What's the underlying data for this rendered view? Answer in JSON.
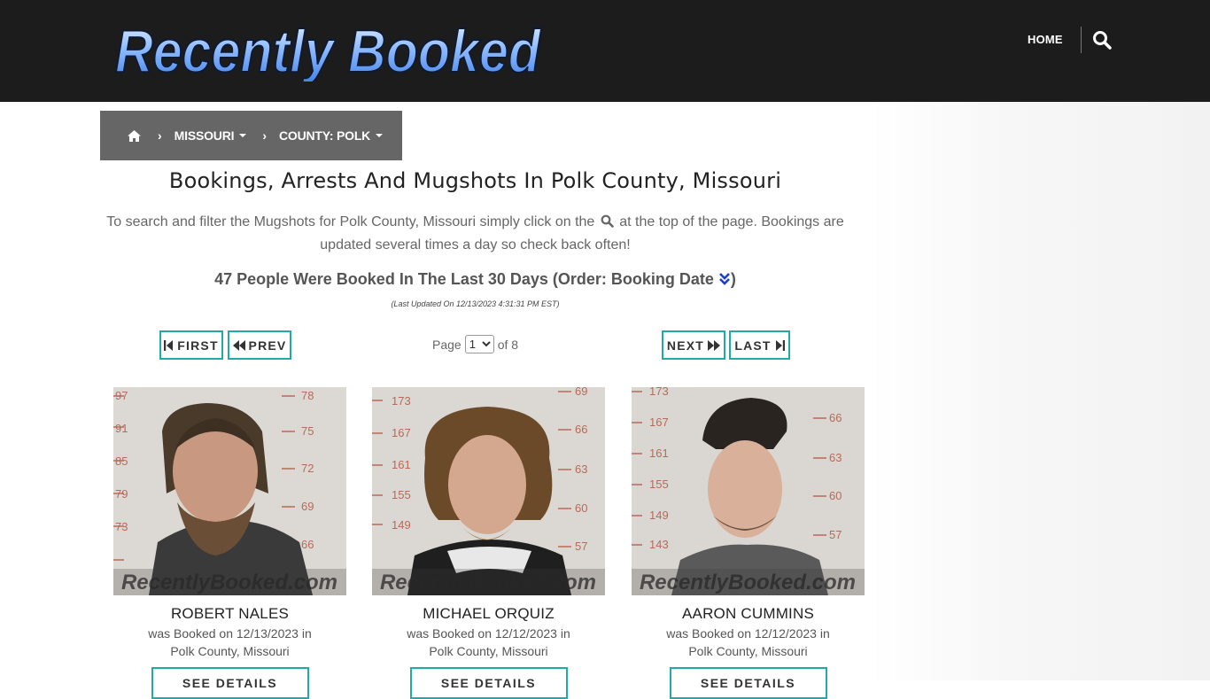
{
  "header": {
    "logo_text": "Recently Booked",
    "nav_home": "HOME"
  },
  "breadcrumb": {
    "state": "MISSOURI",
    "county": "COUNTY: POLK"
  },
  "page": {
    "title": "Bookings, Arrests And Mugshots In Polk County, Missouri",
    "intro_before": "To search and filter the Mugshots for Polk County, Missouri simply click on the",
    "intro_after": "at the top of the page. Bookings are updated several times a day so check back often!",
    "count_text": "47 People Were Booked In The Last 30 Days (Order: Booking Date",
    "count_close": ")",
    "last_updated": "(Last Updated On 12/13/2023 4:31:31 PM EST)"
  },
  "pagination": {
    "first": "FIRST",
    "prev": "PREV",
    "next": "NEXT",
    "last": "LAST",
    "page_label": "Page",
    "current_page": "1",
    "of_label": "of 8"
  },
  "bookings": [
    {
      "name": "ROBERT NALES",
      "line1": "was Booked on 12/13/2023 in",
      "line2": "Polk County, Missouri",
      "button": "SEE DETAILS"
    },
    {
      "name": "MICHAEL ORQUIZ",
      "line1": "was Booked on 12/12/2023 in",
      "line2": "Polk County, Missouri",
      "button": "SEE DETAILS"
    },
    {
      "name": "AARON CUMMINS",
      "line1": "was Booked on 12/12/2023 in",
      "line2": "Polk County, Missouri",
      "button": "SEE DETAILS"
    }
  ],
  "colors": {
    "accent_teal": "#22aaa6",
    "header_bg": "#1c1c1c",
    "breadcrumb_bg": "#666666",
    "logo_blue": "#6ea8ff"
  },
  "icons": {
    "home": "home-icon",
    "search": "search-icon",
    "order": "double-chevron-down-icon"
  }
}
